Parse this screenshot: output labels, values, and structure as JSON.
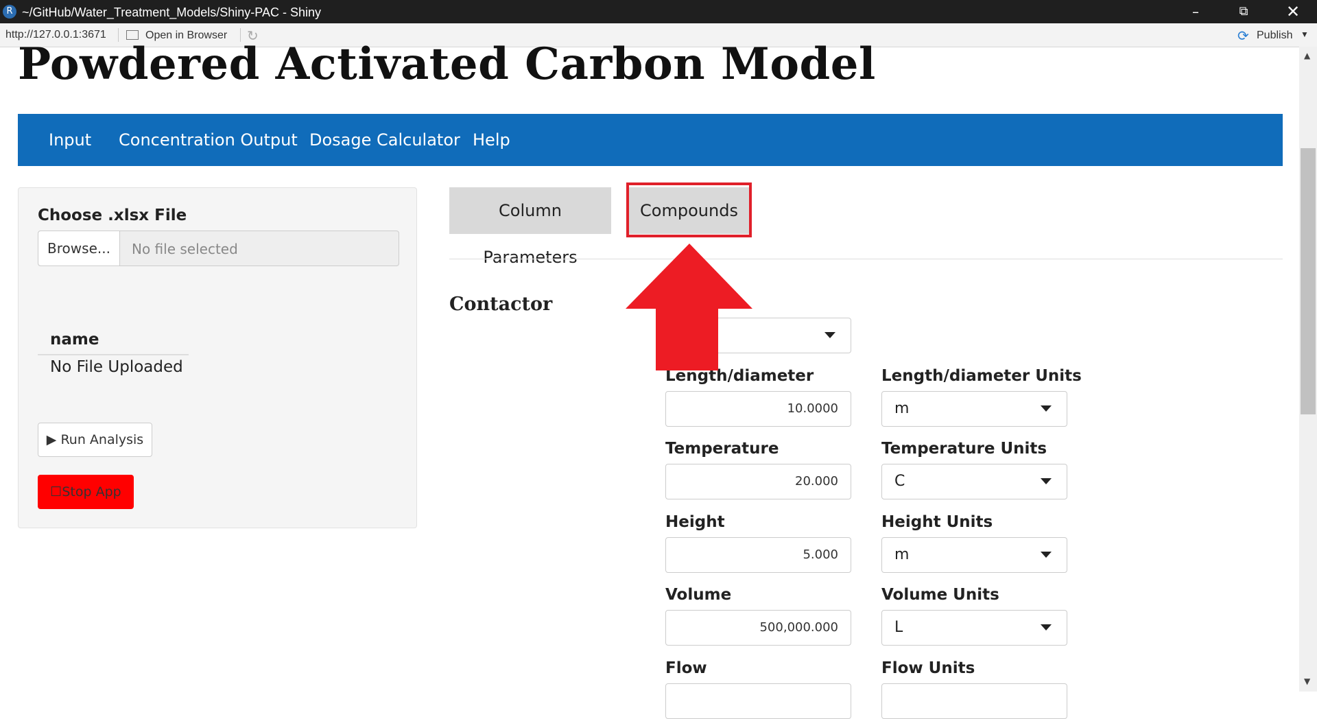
{
  "window": {
    "title": "~/GitHub/Water_Treatment_Models/Shiny-PAC - Shiny",
    "app_icon": "R",
    "controls": [
      "minimize-icon",
      "restore-icon",
      "close-icon"
    ]
  },
  "toolbar": {
    "url": "http://127.0.0.1:3671",
    "open_in_browser": "Open in Browser",
    "publish": "Publish"
  },
  "page": {
    "title": "Powdered Activated Carbon Model",
    "nav": [
      "Input",
      "Concentration Output",
      "Dosage Calculator",
      "Help"
    ]
  },
  "sidebar": {
    "file_label": "Choose .xlsx File",
    "browse": "Browse...",
    "file_placeholder": "No file selected",
    "table_header": "name",
    "table_value": "No File Uploaded",
    "run_button": "Run Analysis",
    "stop_button": "Stop App"
  },
  "tabs": [
    "Column Parameters",
    "Compounds"
  ],
  "annotation": {
    "highlighted_tab": "Compounds",
    "color": "#e0202a"
  },
  "contactor": {
    "title": "Contactor",
    "type_value_partial": "e",
    "fields": [
      {
        "label": "Length/diameter",
        "value": "10.0000",
        "units_label": "Length/diameter Units",
        "units": "m"
      },
      {
        "label": "Temperature",
        "value": "20.000",
        "units_label": "Temperature Units",
        "units": "C"
      },
      {
        "label": "Height",
        "value": "5.000",
        "units_label": "Height Units",
        "units": "m"
      },
      {
        "label": "Volume",
        "value": "500,000.000",
        "units_label": "Volume Units",
        "units": "L"
      },
      {
        "label": "Flow",
        "value": "",
        "units_label": "Flow Units",
        "units": ""
      }
    ]
  },
  "colors": {
    "navbar": "#106cba",
    "stop_button": "#ff0000",
    "arrow": "#ed1c24"
  }
}
